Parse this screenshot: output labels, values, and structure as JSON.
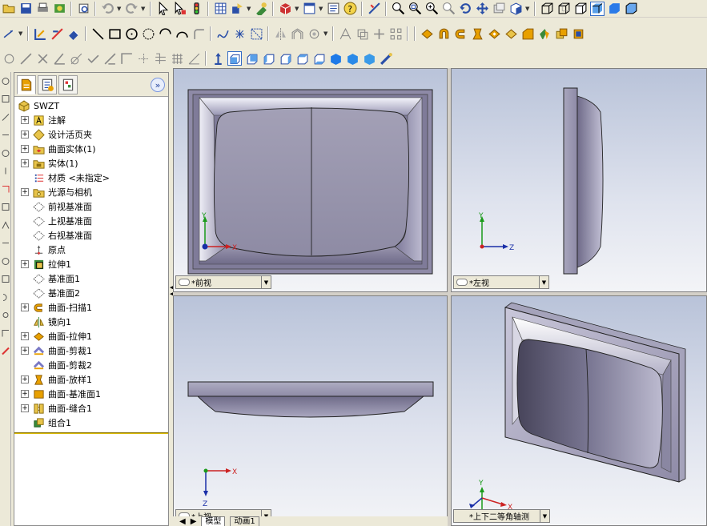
{
  "feature_tree": {
    "root": "SWZT",
    "items": [
      {
        "label": "注解",
        "expandable": true,
        "icon": "annotation-icon"
      },
      {
        "label": "设计活页夹",
        "expandable": true,
        "icon": "design-binder-icon"
      },
      {
        "label": "曲面实体(1)",
        "expandable": true,
        "icon": "surface-body-folder-icon"
      },
      {
        "label": "实体(1)",
        "expandable": true,
        "icon": "solid-body-folder-icon"
      },
      {
        "label": "材质 <未指定>",
        "expandable": false,
        "icon": "material-icon"
      },
      {
        "label": "光源与相机",
        "expandable": true,
        "icon": "lights-camera-icon"
      },
      {
        "label": "前视基准面",
        "expandable": false,
        "icon": "plane-icon"
      },
      {
        "label": "上视基准面",
        "expandable": false,
        "icon": "plane-icon"
      },
      {
        "label": "右视基准面",
        "expandable": false,
        "icon": "plane-icon"
      },
      {
        "label": "原点",
        "expandable": false,
        "icon": "origin-icon"
      },
      {
        "label": "拉伸1",
        "expandable": true,
        "icon": "extrude-icon"
      },
      {
        "label": "基准面1",
        "expandable": false,
        "icon": "plane-icon"
      },
      {
        "label": "基准面2",
        "expandable": false,
        "icon": "plane-icon"
      },
      {
        "label": "曲面-扫描1",
        "expandable": true,
        "icon": "sweep-surface-icon"
      },
      {
        "label": "镜向1",
        "expandable": false,
        "icon": "mirror-icon"
      },
      {
        "label": "曲面-拉伸1",
        "expandable": true,
        "icon": "extrude-surface-icon"
      },
      {
        "label": "曲面-剪裁1",
        "expandable": true,
        "icon": "trim-surface-icon"
      },
      {
        "label": "曲面-剪裁2",
        "expandable": false,
        "icon": "trim-surface-icon"
      },
      {
        "label": "曲面-放样1",
        "expandable": true,
        "icon": "loft-surface-icon"
      },
      {
        "label": "曲面-基准面1",
        "expandable": true,
        "icon": "planar-surface-icon"
      },
      {
        "label": "曲面-缝合1",
        "expandable": true,
        "icon": "knit-surface-icon"
      },
      {
        "label": "组合1",
        "expandable": false,
        "icon": "combine-icon"
      }
    ]
  },
  "viewports": {
    "front": {
      "label": "*前视"
    },
    "left": {
      "label": "*左视"
    },
    "top": {
      "label": "*上视"
    },
    "iso": {
      "label": "*上下二等角轴测"
    }
  },
  "axes": {
    "x": "X",
    "y": "Y",
    "z": "Z"
  },
  "bottom_tabs": {
    "model": "模型",
    "animation": "动画1"
  },
  "colors": {
    "accent": "#316ac5",
    "rollback_bar": "#d7b800",
    "viewport_top": "#b9c3d9"
  }
}
